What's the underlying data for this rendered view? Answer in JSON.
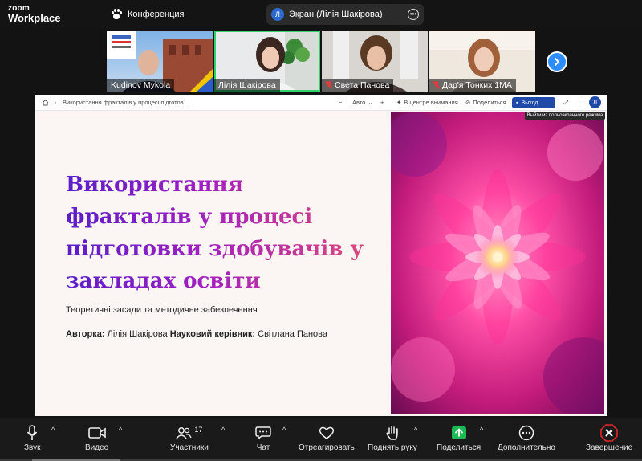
{
  "app": {
    "logo_line1": "zoom",
    "logo_line2": "Workplace",
    "meeting_title": "Конференция"
  },
  "screen_share": {
    "avatar_initial": "Л",
    "label": "Экран (Лілія Шакірова)"
  },
  "participants": [
    {
      "name": "Kudinov Mykola",
      "muted": false,
      "active": false
    },
    {
      "name": "Лілія Шакірова",
      "muted": false,
      "active": true
    },
    {
      "name": "Света Панова",
      "muted": true,
      "active": false
    },
    {
      "name": "Дар'я Тонких 1МА",
      "muted": true,
      "active": false
    }
  ],
  "toolbar": {
    "breadcrumb": "Використання фракталів у процесі підготов...",
    "zoom_mode": "Авто",
    "minus": "−",
    "plus": "+",
    "focus": "В центре внимания",
    "share": "Поделиться",
    "exit": "Выход",
    "avatar": "Л",
    "tooltip": "Выйти из полноэкранного режима"
  },
  "slide": {
    "title": "Використання фракталів у процесі підготовки здобувачів у закладах освіти",
    "subtitle": "Теоретичні засади та методичне забезпечення",
    "author_label": "Авторка:",
    "author": "Лілія Шакірова",
    "supervisor_label": "Науковий керівник:",
    "supervisor": "Світлана Панова"
  },
  "controls": {
    "audio": "Звук",
    "video": "Видео",
    "participants": "Участники",
    "participants_count": "17",
    "chat": "Чат",
    "react": "Отреагировать",
    "raise_hand": "Поднять руку",
    "share": "Поделиться",
    "more": "Дополнительно",
    "end": "Завершение"
  },
  "colors": {
    "accent": "#2d8cff",
    "share_green": "#1db954",
    "end_red": "#e02828",
    "active_border": "#2fd36a"
  }
}
